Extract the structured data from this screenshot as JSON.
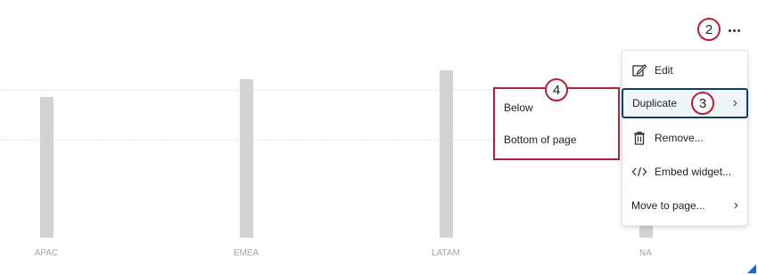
{
  "chart_data": {
    "type": "bar",
    "categories": [
      "APAC",
      "EMEA",
      "LATAM",
      "NA"
    ],
    "values": [
      158,
      178,
      188,
      20
    ],
    "ylim": [
      0,
      200
    ],
    "grid": true,
    "bar_color": "#d3d3d3"
  },
  "widget_menu": {
    "more_icon": "ellipsis-icon",
    "items": [
      {
        "label": "Edit",
        "icon": "edit-icon"
      },
      {
        "label": "Duplicate",
        "icon": "",
        "has_submenu": true
      },
      {
        "label": "Remove...",
        "icon": "trash-icon"
      },
      {
        "label": "Embed widget...",
        "icon": "code-icon"
      },
      {
        "label": "Move to page...",
        "icon": "",
        "has_submenu": true
      }
    ]
  },
  "duplicate_submenu": {
    "items": [
      {
        "label": "Below"
      },
      {
        "label": "Bottom of page"
      }
    ]
  },
  "callouts": {
    "more": "2",
    "duplicate": "3",
    "submenu": "4"
  },
  "colors": {
    "callout": "#b22234",
    "active_border": "#0b3f6e",
    "corner": "#1769c2"
  }
}
